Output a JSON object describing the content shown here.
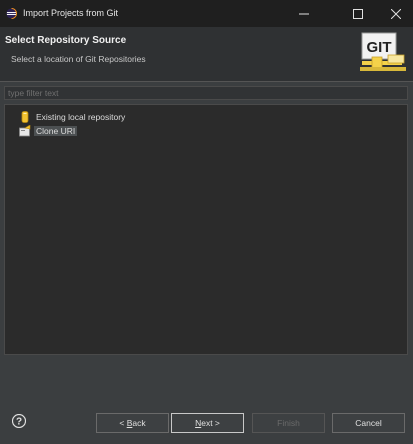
{
  "window": {
    "title": "Import Projects from Git"
  },
  "banner": {
    "title": "Select Repository Source",
    "subtitle": "Select a location of Git Repositories",
    "logo_text": "GIT"
  },
  "filter": {
    "placeholder": "type filter text",
    "value": ""
  },
  "tree": {
    "items": [
      {
        "label": "Existing local repository",
        "icon": "repository-icon",
        "selected": false
      },
      {
        "label": "Clone URI",
        "icon": "clone-icon",
        "selected": true
      }
    ]
  },
  "buttons": {
    "back": {
      "prefix": "< ",
      "mnemonic": "B",
      "rest": "ack"
    },
    "next": {
      "mnemonic": "N",
      "rest": "ext >"
    },
    "finish": {
      "label": "Finish",
      "enabled": false
    },
    "cancel": {
      "label": "Cancel"
    }
  },
  "colors": {
    "title_bar": "#1f1f1f",
    "dialog_bg": "#3b3e40",
    "banner_bg": "#2f3133",
    "tree_bg": "#2b2b2b",
    "selection": "#4c5052",
    "git_logo_accent": "#f4d24a"
  }
}
